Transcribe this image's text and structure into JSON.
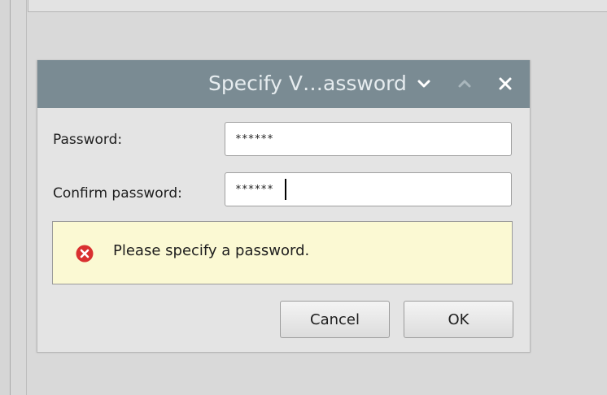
{
  "dialog": {
    "title": "Specify V…assword",
    "password_label": "Password:",
    "password_value": "******",
    "confirm_label": "Confirm password:",
    "confirm_value": "******",
    "error_message": "Please specify a password.",
    "cancel_label": "Cancel",
    "ok_label": "OK"
  },
  "icons": {
    "minimize": "chevron-down-icon",
    "maximize": "chevron-up-icon",
    "close": "close-icon",
    "error": "error-icon"
  },
  "colors": {
    "titlebar": "#7a8b93",
    "error_background": "#fbf9d3",
    "error_icon": "#d93030"
  }
}
